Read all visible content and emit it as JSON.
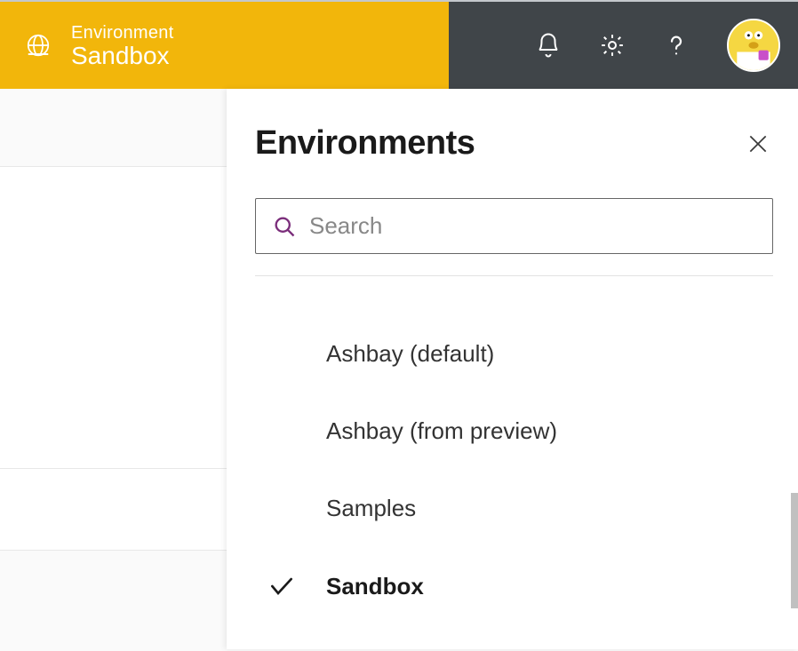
{
  "header": {
    "env_label": "Environment",
    "env_name": "Sandbox"
  },
  "panel": {
    "title": "Environments",
    "search_placeholder": "Search",
    "items": [
      {
        "name": "Ashbay (default)",
        "selected": false
      },
      {
        "name": "Ashbay (from preview)",
        "selected": false
      },
      {
        "name": "Samples",
        "selected": false
      },
      {
        "name": "Sandbox",
        "selected": true
      }
    ]
  },
  "icons": {
    "globe": "globe-icon",
    "bell": "bell-icon",
    "gear": "gear-icon",
    "help": "help-icon",
    "close": "close-icon",
    "search": "search-icon",
    "check": "check-icon",
    "avatar": "avatar"
  }
}
